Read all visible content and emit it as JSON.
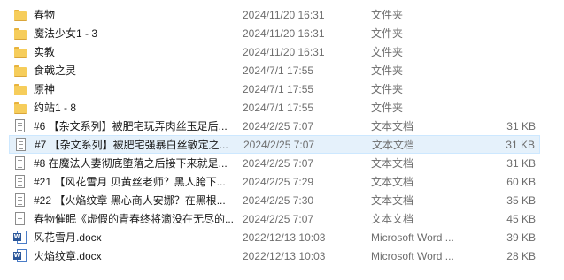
{
  "files": [
    {
      "name": "春物",
      "date": "2024/11/20 16:31",
      "type": "文件夹",
      "size": "",
      "icon": "folder-icon"
    },
    {
      "name": "魔法少女1 - 3",
      "date": "2024/11/20 16:31",
      "type": "文件夹",
      "size": "",
      "icon": "folder-icon"
    },
    {
      "name": "实教",
      "date": "2024/11/20 16:31",
      "type": "文件夹",
      "size": "",
      "icon": "folder-icon"
    },
    {
      "name": "食戟之灵",
      "date": "2024/7/1 17:55",
      "type": "文件夹",
      "size": "",
      "icon": "folder-icon"
    },
    {
      "name": "原神",
      "date": "2024/7/1 17:55",
      "type": "文件夹",
      "size": "",
      "icon": "folder-icon"
    },
    {
      "name": "约站1 - 8",
      "date": "2024/7/1 17:55",
      "type": "文件夹",
      "size": "",
      "icon": "folder-icon"
    },
    {
      "name": "#6 【杂文系列】被肥宅玩弄肉丝玉足后...",
      "date": "2024/2/25 7:07",
      "type": "文本文档",
      "size": "31 KB",
      "icon": "text-document-icon"
    },
    {
      "name": "#7 【杂文系列】被肥宅强暴白丝敏定之...",
      "date": "2024/2/25 7:07",
      "type": "文本文档",
      "size": "31 KB",
      "icon": "text-document-icon"
    },
    {
      "name": "#8 在魔法人妻彻底堕落之后接下来就是...",
      "date": "2024/2/25 7:07",
      "type": "文本文档",
      "size": "31 KB",
      "icon": "text-document-icon"
    },
    {
      "name": "#21 【风花雪月 贝黄丝老师？黑人胯下...",
      "date": "2024/2/25 7:29",
      "type": "文本文档",
      "size": "60 KB",
      "icon": "text-document-icon"
    },
    {
      "name": "#22 【火焰纹章 黑心商人安娜？在黑根...",
      "date": "2024/2/25 7:30",
      "type": "文本文档",
      "size": "35 KB",
      "icon": "text-document-icon"
    },
    {
      "name": "春物催眠《虚假的青春终将滴没在无尽的...",
      "date": "2024/2/25 7:07",
      "type": "文本文档",
      "size": "45 KB",
      "icon": "text-document-icon"
    },
    {
      "name": "风花雪月.docx",
      "date": "2022/12/13 10:03",
      "type": "Microsoft Word ...",
      "size": "39 KB",
      "icon": "word-document-icon"
    },
    {
      "name": "火焰纹章.docx",
      "date": "2022/12/13 10:03",
      "type": "Microsoft Word ...",
      "size": "28 KB",
      "icon": "word-document-icon"
    }
  ],
  "selected_index": 7
}
